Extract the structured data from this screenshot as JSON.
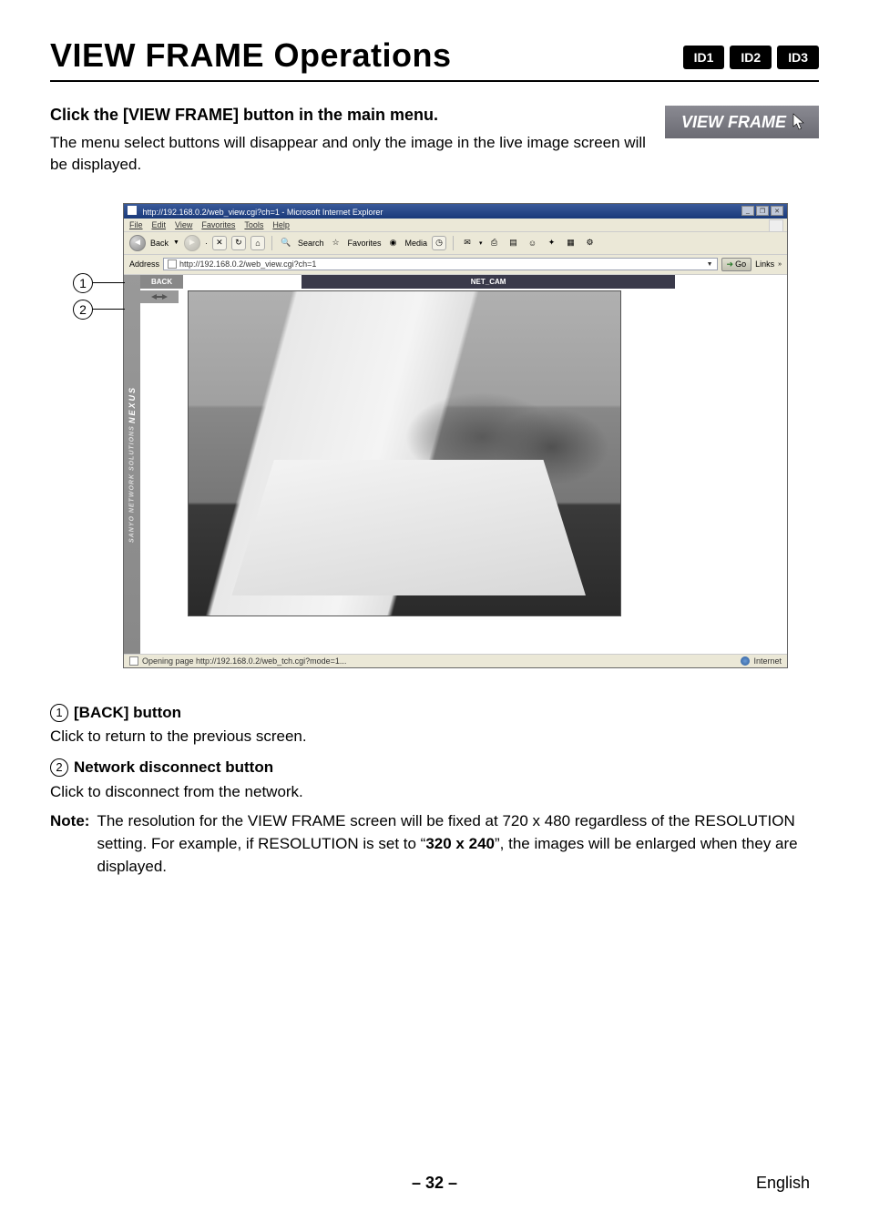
{
  "header": {
    "title": "VIEW FRAME Operations",
    "ids": [
      "ID1",
      "ID2",
      "ID3"
    ]
  },
  "instruction": {
    "title": "Click the [VIEW FRAME] button in the main menu.",
    "desc": "The menu select buttons will disappear and only the image in the live image screen will be displayed.",
    "button_label": "VIEW FRAME"
  },
  "browser": {
    "window_title": "http://192.168.0.2/web_view.cgi?ch=1 - Microsoft Internet Explorer",
    "menus": [
      "File",
      "Edit",
      "View",
      "Favorites",
      "Tools",
      "Help"
    ],
    "toolbar": {
      "back": "Back",
      "search": "Search",
      "favorites": "Favorites",
      "media": "Media"
    },
    "address_label": "Address",
    "address_url": "http://192.168.0.2/web_view.cgi?ch=1",
    "go_label": "Go",
    "links_label": "Links",
    "sidebar_brand_top": "NEXUS",
    "sidebar_brand_sub": "SANYO NETWORK SOLUTIONS",
    "back_button": "BACK",
    "cam_title": "NET_CAM",
    "status_left": "Opening page http://192.168.0.2/web_tch.cgi?mode=1...",
    "status_right": "Internet"
  },
  "callouts": {
    "one": "1",
    "two": "2"
  },
  "descriptions": {
    "item1_label": "[BACK] button",
    "item1_text": "Click to return to the previous screen.",
    "item2_label": "Network disconnect button",
    "item2_text": "Click to disconnect from the network.",
    "note_label": "Note:",
    "note_text_1": "The resolution for the VIEW FRAME screen will be fixed at 720 x 480 regardless of the RESOLUTION setting. For example, if RESOLUTION is set to “",
    "note_bold": "320 x 240",
    "note_text_2": "”, the images will be enlarged when they are displayed."
  },
  "footer": {
    "page": "– 32 –",
    "lang": "English"
  }
}
